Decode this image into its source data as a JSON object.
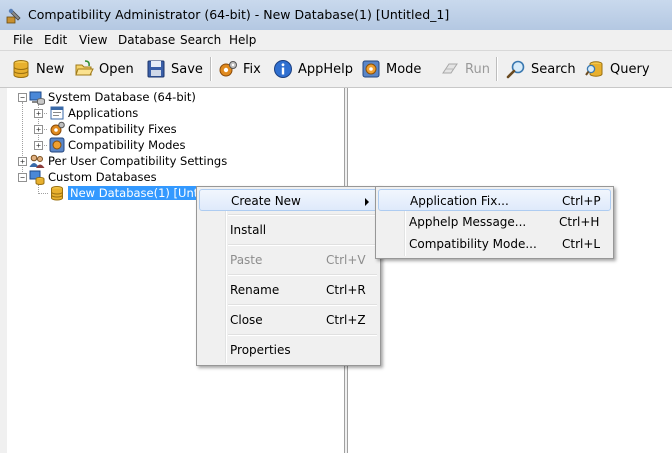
{
  "window": {
    "title": "Compatibility Administrator (64-bit) - New Database(1) [Untitled_1]"
  },
  "menubar": [
    "File",
    "Edit",
    "View",
    "Database",
    "Search",
    "Help"
  ],
  "toolbar": {
    "new": "New",
    "open": "Open",
    "save": "Save",
    "fix": "Fix",
    "apphelp": "AppHelp",
    "mode": "Mode",
    "run": "Run",
    "search": "Search",
    "query": "Query"
  },
  "tree": {
    "system_db": "System Database (64-bit)",
    "applications": "Applications",
    "fixes": "Compatibility Fixes",
    "modes": "Compatibility Modes",
    "per_user": "Per User Compatibility Settings",
    "custom_dbs": "Custom Databases",
    "new_db": "New Database(1) [Untitled_1]"
  },
  "context_menu": {
    "create_new": "Create New",
    "install": "Install",
    "paste": "Paste",
    "paste_sc": "Ctrl+V",
    "rename": "Rename",
    "rename_sc": "Ctrl+R",
    "close": "Close",
    "close_sc": "Ctrl+Z",
    "properties": "Properties"
  },
  "submenu": {
    "app_fix": "Application Fix...",
    "app_fix_sc": "Ctrl+P",
    "apphelp_msg": "Apphelp Message...",
    "apphelp_msg_sc": "Ctrl+H",
    "compat_mode": "Compatibility Mode...",
    "compat_mode_sc": "Ctrl+L"
  }
}
